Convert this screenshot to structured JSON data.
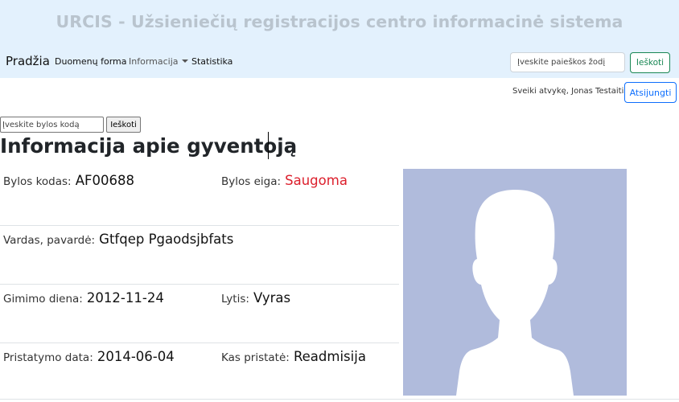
{
  "header": {
    "app_title": "URCIS - Užsieniečių registracijos centro informacinė sistema"
  },
  "nav": {
    "brand": "Pradžia",
    "items": [
      {
        "label": "Duomenų forma"
      },
      {
        "label": "Informacija",
        "dropdown": true
      },
      {
        "label": "Statistika"
      }
    ],
    "search_placeholder": "Įveskite paieškos žodį",
    "search_button": "Ieškoti"
  },
  "user": {
    "greeting": "Sveiki atvykę, Jonas Testaitis",
    "logout_label": "Atsijungti"
  },
  "case_search": {
    "placeholder": "Įveskite bylos kodą",
    "button": "Ieškoti"
  },
  "page": {
    "title": "Informacija apie gyventoją"
  },
  "resident": {
    "case_code_label": "Bylos kodas:",
    "case_code": "AF00688",
    "case_status_label": "Bylos eiga:",
    "case_status": "Saugoma",
    "name_label": "Vardas, pavardė:",
    "name": "Gtfqep Pgaodsjbfats",
    "birth_date_label": "Gimimo diena:",
    "birth_date": "2012-11-24",
    "gender_label": "Lytis:",
    "gender": "Vyras",
    "delivery_date_label": "Pristatymo data:",
    "delivery_date": "2014-06-04",
    "delivered_by_label": "Kas pristatė:",
    "delivered_by": "Readmisija"
  },
  "colors": {
    "banner_bg": "#e3f1fd",
    "title_text": "#b9c4ce",
    "status_red": "#dc1f2c",
    "search_btn_green": "#198754",
    "logout_btn_blue": "#0d6efd",
    "photo_bg": "#b0bbdc"
  },
  "icons": {
    "profile_photo": "person-silhouette-icon",
    "dropdown": "caret-down-icon"
  }
}
